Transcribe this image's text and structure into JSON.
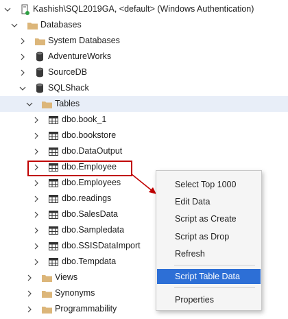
{
  "server": {
    "label": "Kashish\\SQL2019GA, <default> (Windows Authentication)"
  },
  "tree": {
    "databases": "Databases",
    "system_databases": "System Databases",
    "adventureworks": "AdventureWorks",
    "sourcedb": "SourceDB",
    "sqlshack": "SQLShack",
    "tables": "Tables",
    "table_items": [
      "dbo.book_1",
      "dbo.bookstore",
      "dbo.DataOutput",
      "dbo.Employee",
      "dbo.Employees",
      "dbo.readings",
      "dbo.SalesData",
      "dbo.Sampledata",
      "dbo.SSISDataImport",
      "dbo.Tempdata"
    ],
    "views": "Views",
    "synonyms": "Synonyms",
    "programmability": "Programmability"
  },
  "context_menu": {
    "items": [
      "Select Top 1000",
      "Edit Data",
      "Script as Create",
      "Script as Drop",
      "Refresh"
    ],
    "highlighted": "Script Table Data",
    "properties": "Properties"
  },
  "colors": {
    "selection_bg": "#e8eef8",
    "highlight": "#2d6fd6",
    "callout": "#c00000",
    "folder": "#dcb67a"
  }
}
